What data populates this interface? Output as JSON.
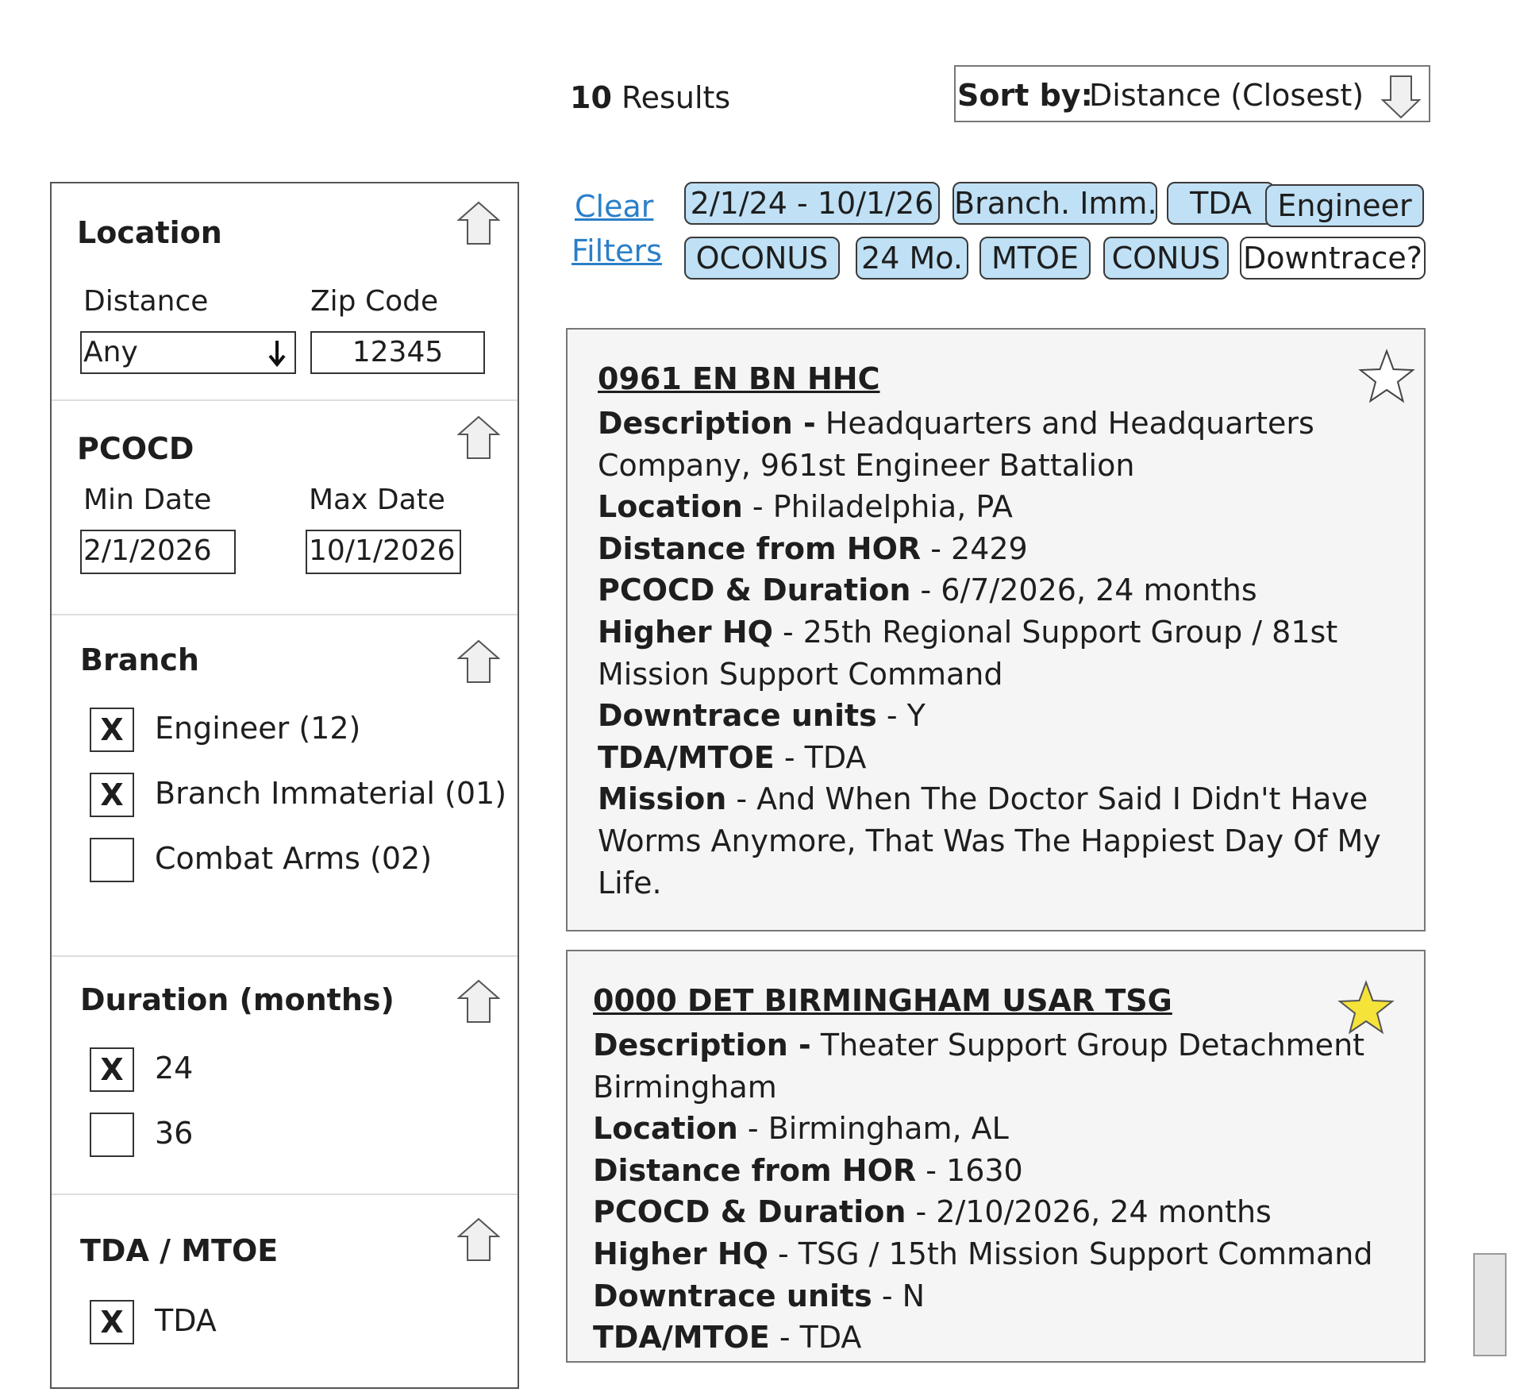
{
  "header": {
    "result_count": "10",
    "results_label": "Results",
    "sort_label": "Sort by:",
    "sort_value": "Distance (Closest)"
  },
  "filters": {
    "location": {
      "title": "Location",
      "distance_label": "Distance",
      "distance_value": "Any",
      "zip_label": "Zip Code",
      "zip_value": "12345"
    },
    "pcocd": {
      "title": "PCOCD",
      "min_label": "Min Date",
      "min_value": "2/1/2026",
      "max_label": "Max Date",
      "max_value": "10/1/2026"
    },
    "branch": {
      "title": "Branch",
      "options": [
        {
          "label": "Engineer (12)",
          "mark": "X",
          "checked": true
        },
        {
          "label": "Branch Immaterial (01)",
          "mark": "X",
          "checked": true
        },
        {
          "label": "Combat Arms (02)",
          "mark": "",
          "checked": false
        }
      ]
    },
    "duration": {
      "title": "Duration (months)",
      "options": [
        {
          "label": "24",
          "mark": "X",
          "checked": true
        },
        {
          "label": "36",
          "mark": "",
          "checked": false
        }
      ]
    },
    "tda_mtoe": {
      "title": "TDA / MTOE",
      "options": [
        {
          "label": "TDA",
          "mark": "X",
          "checked": true
        }
      ]
    }
  },
  "active_filters": {
    "clear_line1": "Clear",
    "clear_line2": "Filters",
    "chips": [
      {
        "label": "2/1/24 - 10/1/26",
        "active": true
      },
      {
        "label": "Branch. Imm.",
        "active": true
      },
      {
        "label": "TDA",
        "active": true
      },
      {
        "label": "Engineer",
        "active": true
      },
      {
        "label": "OCONUS",
        "active": true
      },
      {
        "label": "24 Mo.",
        "active": true
      },
      {
        "label": "MTOE",
        "active": true
      },
      {
        "label": "CONUS",
        "active": true
      },
      {
        "label": "Downtrace?",
        "active": false
      }
    ]
  },
  "results": [
    {
      "title": "0961 EN BN HHC",
      "favorited": false,
      "fields": {
        "description_label": "Description -",
        "description": " Headquarters and Headquarters Company, 961st Engineer Battalion",
        "location_label": "Location",
        "location": " - Philadelphia, PA",
        "distance_label": "Distance from HOR",
        "distance": " - 2429",
        "pcocd_label": "PCOCD & Duration",
        "pcocd": " - 6/7/2026, 24 months",
        "higher_hq_label": "Higher HQ",
        "higher_hq": " - 25th Regional Support Group / 81st Mission Support Command",
        "downtrace_label": "Downtrace units",
        "downtrace": " - Y",
        "tda_label": "TDA/MTOE",
        "tda": " - TDA",
        "mission_label": "Mission",
        "mission": " - And When The Doctor Said I Didn't Have Worms Anymore, That Was The Happiest Day Of My Life."
      }
    },
    {
      "title": "0000 DET BIRMINGHAM USAR TSG",
      "favorited": true,
      "fields": {
        "description_label": "Description -",
        "description": " Theater Support Group Detachment Birmingham",
        "location_label": "Location",
        "location": " - Birmingham, AL",
        "distance_label": "Distance from HOR",
        "distance": " - 1630",
        "pcocd_label": "PCOCD & Duration",
        "pcocd": " - 2/10/2026, 24 months",
        "higher_hq_label": "Higher HQ",
        "higher_hq": " - TSG / 15th Mission Support Command",
        "downtrace_label": "Downtrace units",
        "downtrace": " - N",
        "tda_label": "TDA/MTOE",
        "tda": " - TDA"
      }
    }
  ],
  "colors": {
    "chip_active": "#bfe0f5",
    "link": "#2a7fc8",
    "star_filled": "#f5e33a",
    "card_bg": "#f5f5f5"
  }
}
